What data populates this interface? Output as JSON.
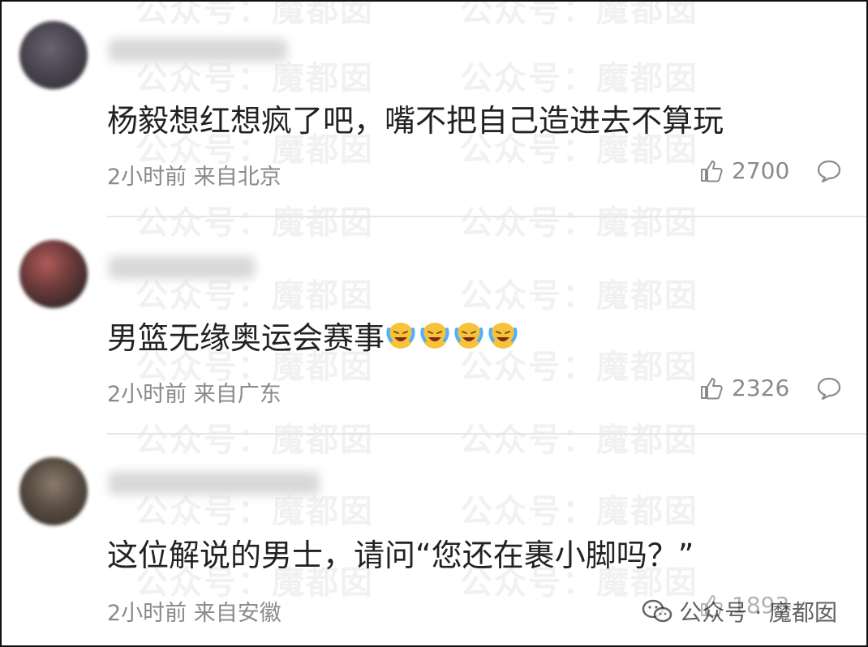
{
  "watermark": {
    "text": "公众号：魔都囡"
  },
  "comments": [
    {
      "text": "杨毅想红想疯了吧，嘴不把自己造进去不算玩",
      "time": "2小时前",
      "location": "来自北京",
      "likes": "2700"
    },
    {
      "text": "男篮无缘奥运会赛事",
      "time": "2小时前",
      "location": "来自广东",
      "likes": "2326",
      "emoji_count": 4,
      "emoji_icon": "laugh-cry-emoji-icon"
    },
    {
      "text": "这位解说的男士，请问“您还在裹小脚吗？”",
      "time": "2小时前",
      "location": "来自安徽",
      "likes": "1893"
    }
  ],
  "icons": {
    "like": "thumbs-up-icon",
    "reply": "comment-bubble-icon"
  },
  "colors": {
    "text": "#222222",
    "meta": "#8a8a8a",
    "divider": "#e6e6e6"
  },
  "logo": {
    "label": "公众号 · 魔都囡"
  }
}
